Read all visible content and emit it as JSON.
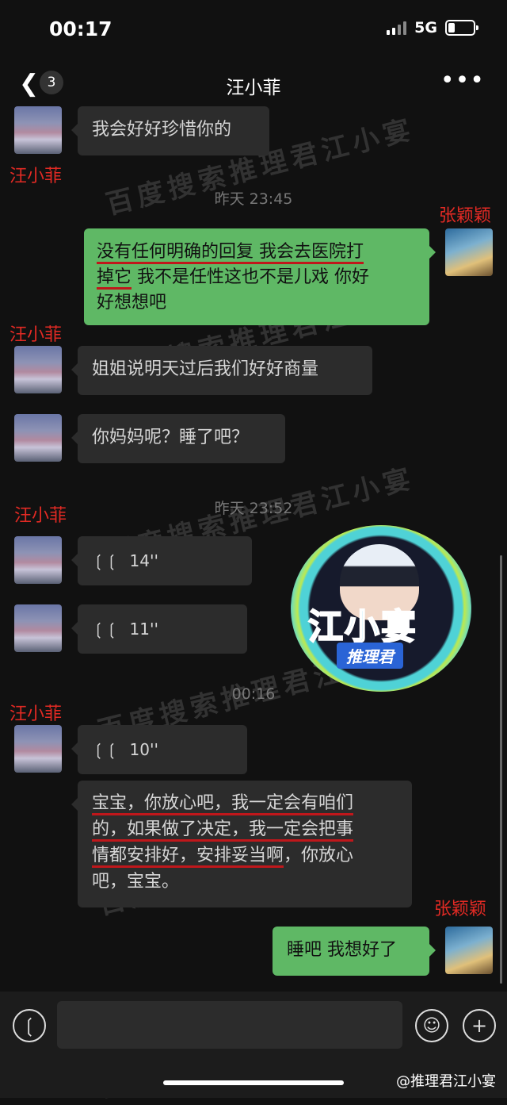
{
  "status": {
    "time": "00:17",
    "network": "5G"
  },
  "nav": {
    "back_icon": "chevron-left-icon",
    "unread_count": "3",
    "title": "汪小菲",
    "more_icon": "more-dots-icon"
  },
  "watermark": "百度搜索推理君江小宴",
  "labels": {
    "wang": "汪小菲",
    "zhang": "张颖颖"
  },
  "timestamps": {
    "t1": "昨天 23:45",
    "t2": "昨天 23:52",
    "t3": "00:16"
  },
  "messages": {
    "m0": "我会好好珍惜你的",
    "m1_line1a": "没有任何明确的回复 我会去医院打",
    "m1_line2a": "掉它",
    "m1_line2b": " 我不是任性这也不是儿戏 你好",
    "m1_line3": "好想想吧",
    "m2": "姐姐说明天过后我们好好商量",
    "m3": "你妈妈呢？睡了吧？",
    "v1": "14''",
    "v2": "11''",
    "v3": "10''",
    "m4_line1": "宝宝，你放心吧，我一定会有咱们",
    "m4_line2": "的，如果做了决定，我一定会把事",
    "m4_line3a": "情都安排好，安排妥当啊",
    "m4_line3b": "，你放心",
    "m4_line4": "吧，宝宝。",
    "m5": "睡吧 我想好了"
  },
  "logo": {
    "main": "江小宴",
    "sub": "推理君"
  },
  "input": {
    "placeholder": ""
  },
  "credit": "@推理君江小宴",
  "colors": {
    "my_bubble": "#5fb865",
    "their_bubble": "#2c2c2c",
    "annotation_red": "#e22a24"
  }
}
